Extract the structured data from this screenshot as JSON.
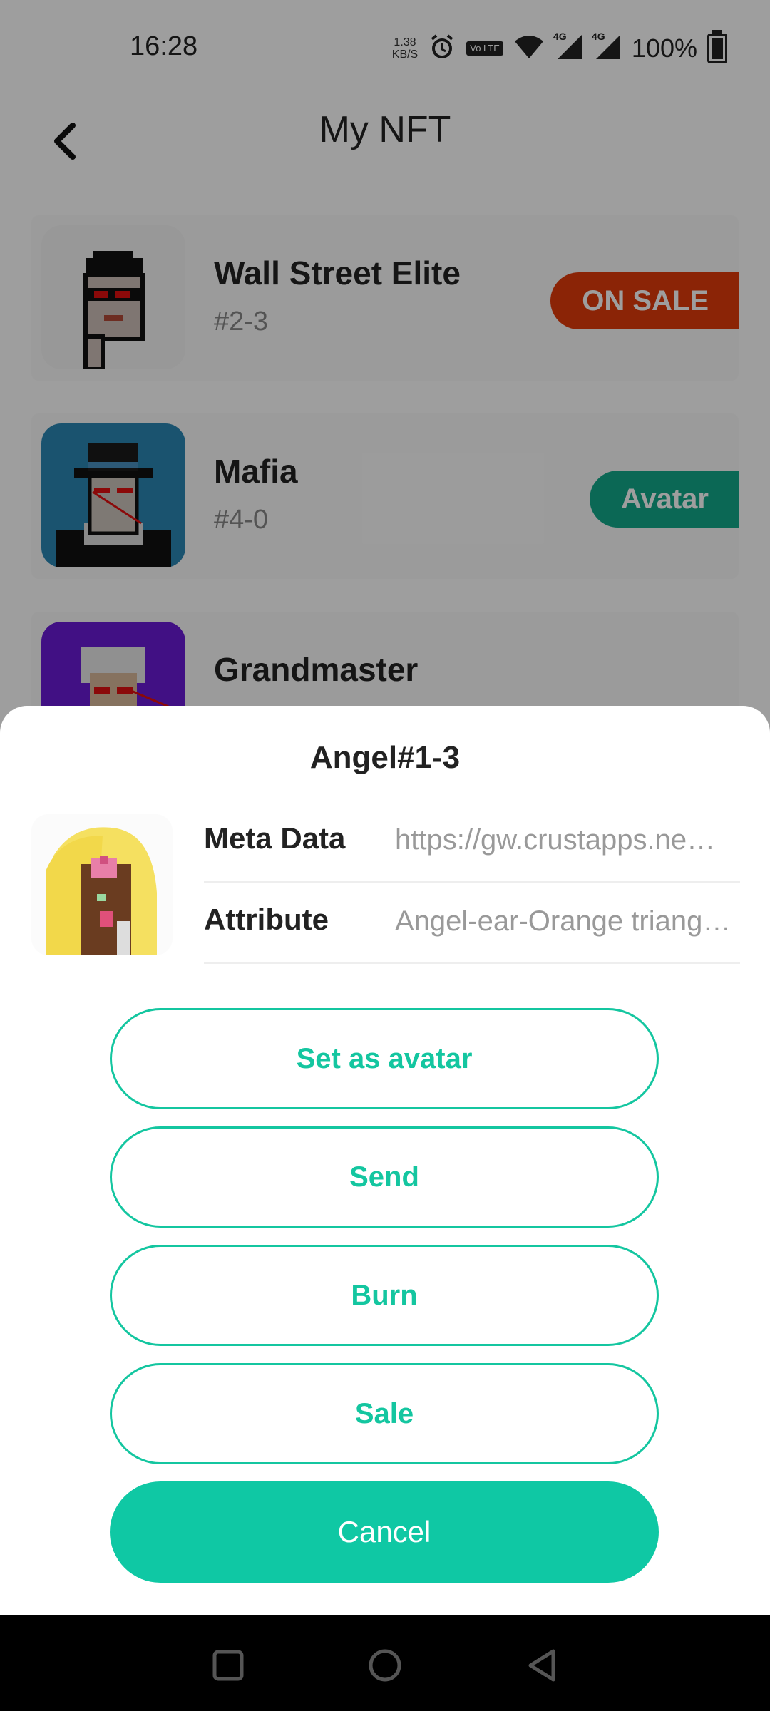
{
  "status_bar": {
    "time": "16:28",
    "net_speed_value": "1.38",
    "net_speed_unit": "KB/S",
    "lte_label": "Vo LTE",
    "signal1_label": "4G",
    "signal2_label": "4G",
    "battery_percent": "100%",
    "icons": [
      "alarm-icon",
      "volte-icon",
      "wifi-icon",
      "signal-4g-icon",
      "signal-4g-icon",
      "battery-charging-icon"
    ]
  },
  "header": {
    "title": "My NFT",
    "back_icon": "chevron-left-icon"
  },
  "nft_list": [
    {
      "name": "Wall Street Elite",
      "id": "#2-3",
      "badge": "ON SALE",
      "badge_color": "#e03a0b"
    },
    {
      "name": "Mafia",
      "id": "#4-0",
      "badge": "Avatar",
      "badge_color": "#13a98a"
    },
    {
      "name": "Grandmaster"
    }
  ],
  "sheet": {
    "title": "Angel#1-3",
    "rows": [
      {
        "label": "Meta Data",
        "value": "https://gw.crustapps.ne…"
      },
      {
        "label": "Attribute",
        "value": "Angel-ear-Orange triang…"
      }
    ],
    "buttons": {
      "set_avatar": "Set as avatar",
      "send": "Send",
      "burn": "Burn",
      "sale": "Sale",
      "cancel": "Cancel"
    }
  },
  "colors": {
    "accent": "#14c6a0",
    "on_sale": "#e03a0b",
    "avatar_badge": "#13a98a"
  },
  "nav_bar": {
    "icons": [
      "recents-square-icon",
      "home-circle-icon",
      "back-triangle-icon"
    ]
  }
}
